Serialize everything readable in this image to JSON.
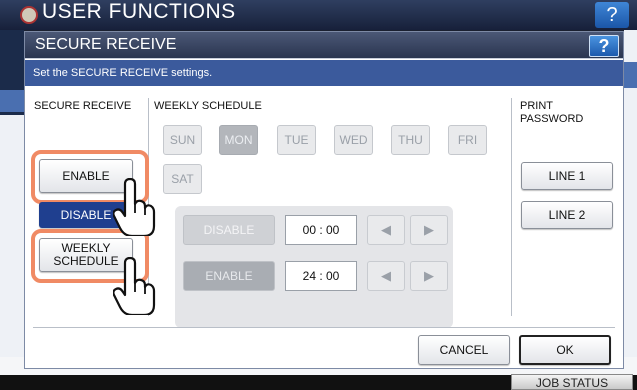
{
  "background": {
    "title": "USER FUNCTIONS",
    "help_label": "?",
    "job_status": "JOB STATUS"
  },
  "dialog": {
    "title": "SECURE RECEIVE",
    "help_label": "?",
    "instruction": "Set the SECURE RECEIVE settings."
  },
  "secure_receive": {
    "heading": "SECURE RECEIVE",
    "enable_label": "ENABLE",
    "disable_label": "DISABLE",
    "weekly_label_line1": "WEEKLY",
    "weekly_label_line2": "SCHEDULE",
    "selected": "DISABLE"
  },
  "weekly_schedule": {
    "heading": "WEEKLY SCHEDULE",
    "days": [
      "SUN",
      "MON",
      "TUE",
      "WED",
      "THU",
      "FRI",
      "SAT"
    ],
    "selected_day": "MON",
    "disable_label": "DISABLE",
    "disable_time": "00 : 00",
    "enable_label": "ENABLE",
    "enable_time": "24 : 00",
    "left_arrow": "◀",
    "right_arrow": "▶"
  },
  "print_password": {
    "heading_line1": "PRINT",
    "heading_line2": "PASSWORD",
    "line1_label": "LINE 1",
    "line2_label": "LINE 2"
  },
  "footer": {
    "cancel_label": "CANCEL",
    "ok_label": "OK"
  },
  "colors": {
    "selected_blue": "#1f3f8f",
    "callout_orange": "#f08a64",
    "header_navy": "#2a3550"
  },
  "icons": [
    "tap-hand-icon",
    "logo-icon"
  ]
}
